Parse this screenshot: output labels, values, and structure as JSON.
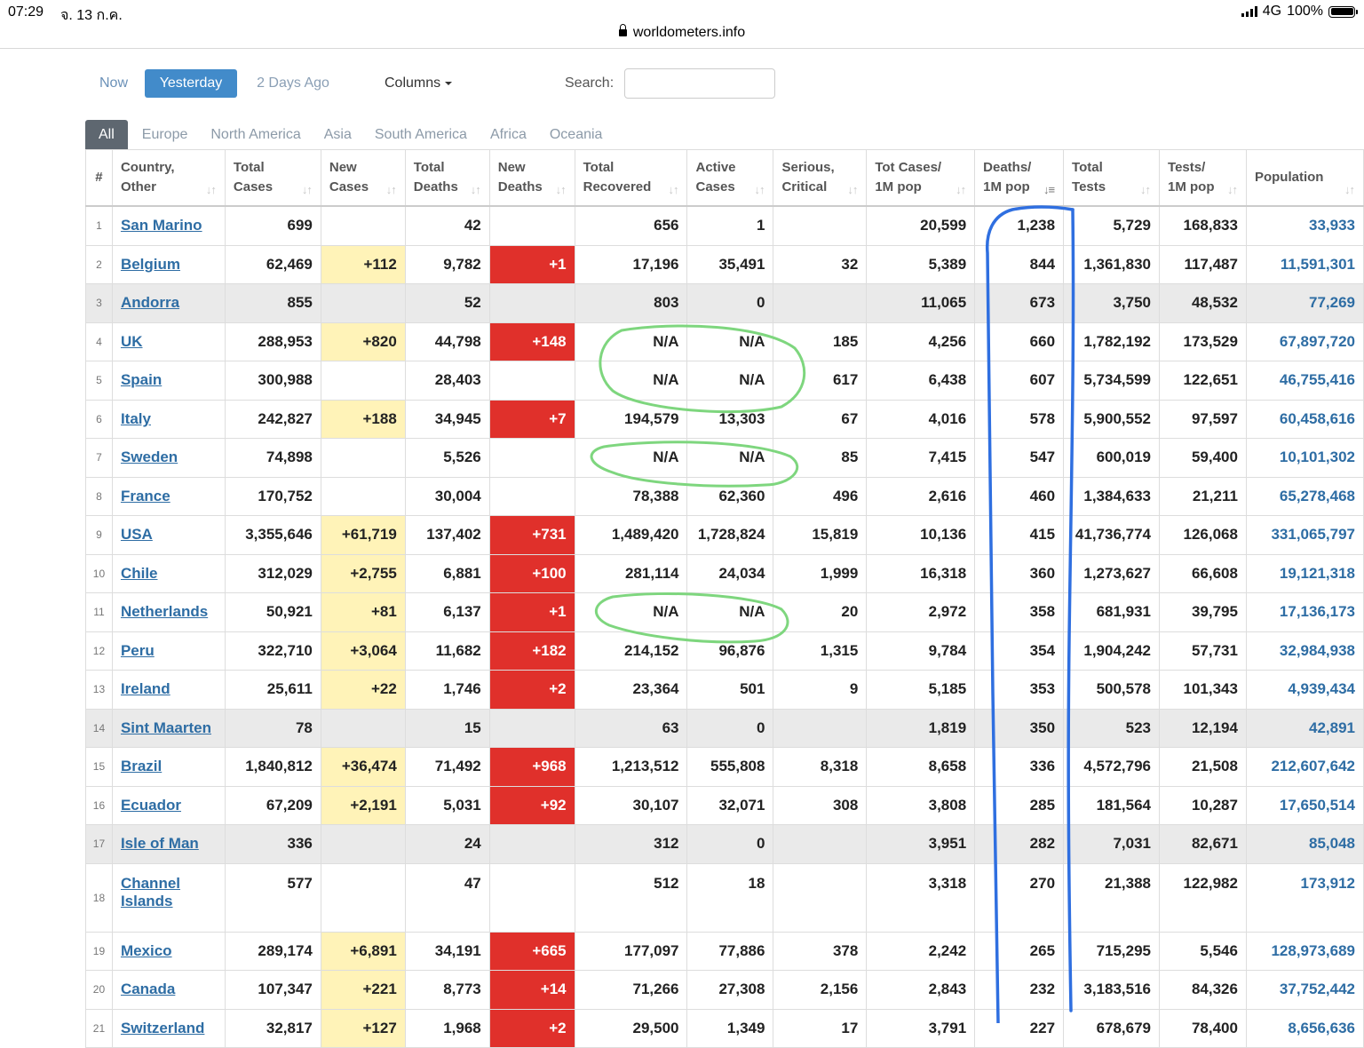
{
  "status_bar": {
    "time": "07:29",
    "date": "จ. 13 ก.ค.",
    "network": "4G",
    "battery": "100%"
  },
  "browser": {
    "url": "worldometers.info"
  },
  "controls": {
    "now": "Now",
    "yesterday": "Yesterday",
    "two_days_ago": "2 Days Ago",
    "columns": "Columns",
    "search_label": "Search:",
    "search_value": ""
  },
  "tabs": [
    "All",
    "Europe",
    "North America",
    "Asia",
    "South America",
    "Africa",
    "Oceania"
  ],
  "active_tab": "All",
  "columns": [
    {
      "l1": "#",
      "l2": ""
    },
    {
      "l1": "Country,",
      "l2": "Other"
    },
    {
      "l1": "Total",
      "l2": "Cases"
    },
    {
      "l1": "New",
      "l2": "Cases"
    },
    {
      "l1": "Total",
      "l2": "Deaths"
    },
    {
      "l1": "New",
      "l2": "Deaths"
    },
    {
      "l1": "Total",
      "l2": "Recovered"
    },
    {
      "l1": "Active",
      "l2": "Cases"
    },
    {
      "l1": "Serious,",
      "l2": "Critical"
    },
    {
      "l1": "Tot Cases/",
      "l2": "1M pop"
    },
    {
      "l1": "Deaths/",
      "l2": "1M pop"
    },
    {
      "l1": "Total",
      "l2": "Tests"
    },
    {
      "l1": "Tests/",
      "l2": "1M pop"
    },
    {
      "l1": "Population",
      "l2": ""
    }
  ],
  "sorted_column": "Deaths/ 1M pop",
  "rows": [
    {
      "n": "1",
      "country": "San Marino",
      "total_cases": "699",
      "new_cases": "",
      "total_deaths": "42",
      "new_deaths": "",
      "total_recovered": "656",
      "active": "1",
      "critical": "",
      "cases_per_m": "20,599",
      "deaths_per_m": "1,238",
      "total_tests": "5,729",
      "tests_per_m": "168,833",
      "population": "33,933",
      "gray": false
    },
    {
      "n": "2",
      "country": "Belgium",
      "total_cases": "62,469",
      "new_cases": "+112",
      "total_deaths": "9,782",
      "new_deaths": "+1",
      "total_recovered": "17,196",
      "active": "35,491",
      "critical": "32",
      "cases_per_m": "5,389",
      "deaths_per_m": "844",
      "total_tests": "1,361,830",
      "tests_per_m": "117,487",
      "population": "11,591,301",
      "gray": false
    },
    {
      "n": "3",
      "country": "Andorra",
      "total_cases": "855",
      "new_cases": "",
      "total_deaths": "52",
      "new_deaths": "",
      "total_recovered": "803",
      "active": "0",
      "critical": "",
      "cases_per_m": "11,065",
      "deaths_per_m": "673",
      "total_tests": "3,750",
      "tests_per_m": "48,532",
      "population": "77,269",
      "gray": true
    },
    {
      "n": "4",
      "country": "UK",
      "total_cases": "288,953",
      "new_cases": "+820",
      "total_deaths": "44,798",
      "new_deaths": "+148",
      "total_recovered": "N/A",
      "active": "N/A",
      "critical": "185",
      "cases_per_m": "4,256",
      "deaths_per_m": "660",
      "total_tests": "1,782,192",
      "tests_per_m": "173,529",
      "population": "67,897,720",
      "gray": false
    },
    {
      "n": "5",
      "country": "Spain",
      "total_cases": "300,988",
      "new_cases": "",
      "total_deaths": "28,403",
      "new_deaths": "",
      "total_recovered": "N/A",
      "active": "N/A",
      "critical": "617",
      "cases_per_m": "6,438",
      "deaths_per_m": "607",
      "total_tests": "5,734,599",
      "tests_per_m": "122,651",
      "population": "46,755,416",
      "gray": false
    },
    {
      "n": "6",
      "country": "Italy",
      "total_cases": "242,827",
      "new_cases": "+188",
      "total_deaths": "34,945",
      "new_deaths": "+7",
      "total_recovered": "194,579",
      "active": "13,303",
      "critical": "67",
      "cases_per_m": "4,016",
      "deaths_per_m": "578",
      "total_tests": "5,900,552",
      "tests_per_m": "97,597",
      "population": "60,458,616",
      "gray": false
    },
    {
      "n": "7",
      "country": "Sweden",
      "total_cases": "74,898",
      "new_cases": "",
      "total_deaths": "5,526",
      "new_deaths": "",
      "total_recovered": "N/A",
      "active": "N/A",
      "critical": "85",
      "cases_per_m": "7,415",
      "deaths_per_m": "547",
      "total_tests": "600,019",
      "tests_per_m": "59,400",
      "population": "10,101,302",
      "gray": false
    },
    {
      "n": "8",
      "country": "France",
      "total_cases": "170,752",
      "new_cases": "",
      "total_deaths": "30,004",
      "new_deaths": "",
      "total_recovered": "78,388",
      "active": "62,360",
      "critical": "496",
      "cases_per_m": "2,616",
      "deaths_per_m": "460",
      "total_tests": "1,384,633",
      "tests_per_m": "21,211",
      "population": "65,278,468",
      "gray": false
    },
    {
      "n": "9",
      "country": "USA",
      "total_cases": "3,355,646",
      "new_cases": "+61,719",
      "total_deaths": "137,402",
      "new_deaths": "+731",
      "total_recovered": "1,489,420",
      "active": "1,728,824",
      "critical": "15,819",
      "cases_per_m": "10,136",
      "deaths_per_m": "415",
      "total_tests": "41,736,774",
      "tests_per_m": "126,068",
      "population": "331,065,797",
      "gray": false
    },
    {
      "n": "10",
      "country": "Chile",
      "total_cases": "312,029",
      "new_cases": "+2,755",
      "total_deaths": "6,881",
      "new_deaths": "+100",
      "total_recovered": "281,114",
      "active": "24,034",
      "critical": "1,999",
      "cases_per_m": "16,318",
      "deaths_per_m": "360",
      "total_tests": "1,273,627",
      "tests_per_m": "66,608",
      "population": "19,121,318",
      "gray": false
    },
    {
      "n": "11",
      "country": "Netherlands",
      "total_cases": "50,921",
      "new_cases": "+81",
      "total_deaths": "6,137",
      "new_deaths": "+1",
      "total_recovered": "N/A",
      "active": "N/A",
      "critical": "20",
      "cases_per_m": "2,972",
      "deaths_per_m": "358",
      "total_tests": "681,931",
      "tests_per_m": "39,795",
      "population": "17,136,173",
      "gray": false
    },
    {
      "n": "12",
      "country": "Peru",
      "total_cases": "322,710",
      "new_cases": "+3,064",
      "total_deaths": "11,682",
      "new_deaths": "+182",
      "total_recovered": "214,152",
      "active": "96,876",
      "critical": "1,315",
      "cases_per_m": "9,784",
      "deaths_per_m": "354",
      "total_tests": "1,904,242",
      "tests_per_m": "57,731",
      "population": "32,984,938",
      "gray": false
    },
    {
      "n": "13",
      "country": "Ireland",
      "total_cases": "25,611",
      "new_cases": "+22",
      "total_deaths": "1,746",
      "new_deaths": "+2",
      "total_recovered": "23,364",
      "active": "501",
      "critical": "9",
      "cases_per_m": "5,185",
      "deaths_per_m": "353",
      "total_tests": "500,578",
      "tests_per_m": "101,343",
      "population": "4,939,434",
      "gray": false
    },
    {
      "n": "14",
      "country": "Sint Maarten",
      "total_cases": "78",
      "new_cases": "",
      "total_deaths": "15",
      "new_deaths": "",
      "total_recovered": "63",
      "active": "0",
      "critical": "",
      "cases_per_m": "1,819",
      "deaths_per_m": "350",
      "total_tests": "523",
      "tests_per_m": "12,194",
      "population": "42,891",
      "gray": true
    },
    {
      "n": "15",
      "country": "Brazil",
      "total_cases": "1,840,812",
      "new_cases": "+36,474",
      "total_deaths": "71,492",
      "new_deaths": "+968",
      "total_recovered": "1,213,512",
      "active": "555,808",
      "critical": "8,318",
      "cases_per_m": "8,658",
      "deaths_per_m": "336",
      "total_tests": "4,572,796",
      "tests_per_m": "21,508",
      "population": "212,607,642",
      "gray": false
    },
    {
      "n": "16",
      "country": "Ecuador",
      "total_cases": "67,209",
      "new_cases": "+2,191",
      "total_deaths": "5,031",
      "new_deaths": "+92",
      "total_recovered": "30,107",
      "active": "32,071",
      "critical": "308",
      "cases_per_m": "3,808",
      "deaths_per_m": "285",
      "total_tests": "181,564",
      "tests_per_m": "10,287",
      "population": "17,650,514",
      "gray": false
    },
    {
      "n": "17",
      "country": "Isle of Man",
      "total_cases": "336",
      "new_cases": "",
      "total_deaths": "24",
      "new_deaths": "",
      "total_recovered": "312",
      "active": "0",
      "critical": "",
      "cases_per_m": "3,951",
      "deaths_per_m": "282",
      "total_tests": "7,031",
      "tests_per_m": "82,671",
      "population": "85,048",
      "gray": true
    },
    {
      "n": "18",
      "country": "Channel Islands",
      "total_cases": "577",
      "new_cases": "",
      "total_deaths": "47",
      "new_deaths": "",
      "total_recovered": "512",
      "active": "18",
      "critical": "",
      "cases_per_m": "3,318",
      "deaths_per_m": "270",
      "total_tests": "21,388",
      "tests_per_m": "122,982",
      "population": "173,912",
      "gray": false
    },
    {
      "n": "19",
      "country": "Mexico",
      "total_cases": "289,174",
      "new_cases": "+6,891",
      "total_deaths": "34,191",
      "new_deaths": "+665",
      "total_recovered": "177,097",
      "active": "77,886",
      "critical": "378",
      "cases_per_m": "2,242",
      "deaths_per_m": "265",
      "total_tests": "715,295",
      "tests_per_m": "5,546",
      "population": "128,973,689",
      "gray": false
    },
    {
      "n": "20",
      "country": "Canada",
      "total_cases": "107,347",
      "new_cases": "+221",
      "total_deaths": "8,773",
      "new_deaths": "+14",
      "total_recovered": "71,266",
      "active": "27,308",
      "critical": "2,156",
      "cases_per_m": "2,843",
      "deaths_per_m": "232",
      "total_tests": "3,183,516",
      "tests_per_m": "84,326",
      "population": "37,752,442",
      "gray": false
    },
    {
      "n": "21",
      "country": "Switzerland",
      "total_cases": "32,817",
      "new_cases": "+127",
      "total_deaths": "1,968",
      "new_deaths": "+2",
      "total_recovered": "29,500",
      "active": "1,349",
      "critical": "17",
      "cases_per_m": "3,791",
      "deaths_per_m": "227",
      "total_tests": "678,679",
      "tests_per_m": "78,400",
      "population": "8,656,636",
      "gray": false
    }
  ],
  "annotations": {
    "green_circle_color": "#7ed67e",
    "blue_bracket_color": "#2f6fe0"
  },
  "colors": {
    "new_cases_bg": "#fff3b8",
    "new_deaths_bg": "#e0302b",
    "link": "#2e6da4",
    "active_button": "#428bca"
  }
}
